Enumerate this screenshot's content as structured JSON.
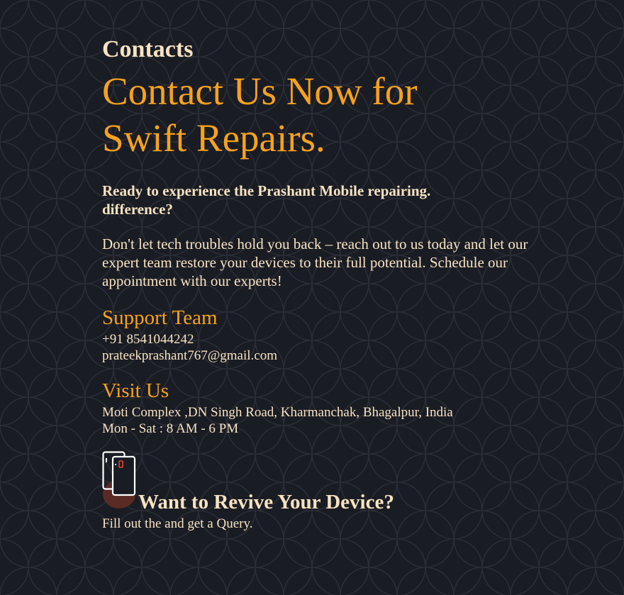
{
  "section_label": "Contacts",
  "headline": "Contact Us Now for Swift Repairs.",
  "lead": "Ready to experience the Prashant Mobile repairing. difference?",
  "body": "Don't let tech troubles hold you back – reach out to us today and let our expert team restore your devices to their full potential. Schedule our appointment with our experts!",
  "support": {
    "heading": "Support Team",
    "phone": "+91 8541044242",
    "email": "prateekprashant767@gmail.com"
  },
  "visit": {
    "heading": "Visit Us",
    "address": "Moti Complex ,DN Singh Road, Kharmanchak, Bhagalpur, India",
    "hours": "Mon - Sat : 8 AM - 6 PM"
  },
  "cta": {
    "icon": "phone-repair-icon",
    "title": "Want to Revive Your Device?",
    "text": "Fill out the and get a Query."
  },
  "colors": {
    "background": "#1a1c24",
    "accent": "#f7a21b",
    "text": "#f7e3c1"
  }
}
